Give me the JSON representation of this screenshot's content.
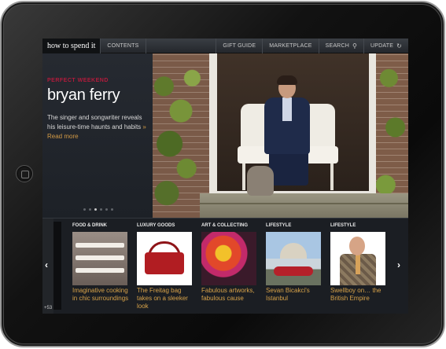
{
  "topbar": {
    "logo": "how to spend it",
    "contents": "CONTENTS",
    "gift_guide": "GIFT GUIDE",
    "marketplace": "MARKETPLACE",
    "search": "SEARCH",
    "update": "UPDATE"
  },
  "hero": {
    "kicker": "PERFECT WEEKEND",
    "headline": "bryan ferry",
    "standfirst": "The singer and songwriter reveals his leisure-time haunts and habits",
    "read_more": "» Read more",
    "active_slide": 3,
    "slide_count": 6
  },
  "strip": {
    "count": "+53",
    "prev_arrow": "‹",
    "next_arrow": "›",
    "cards": [
      {
        "category": "FOOD & DRINK",
        "title": "Imaginative cooking in chic surroundings"
      },
      {
        "category": "LUXURY GOODS",
        "title": "The Freitag bag takes on a sleeker look"
      },
      {
        "category": "ART & COLLECTING",
        "title": "Fabulous artworks, fabulous cause"
      },
      {
        "category": "LIFESTYLE",
        "title": "Sevan Bicakci's Istanbul"
      },
      {
        "category": "LIFESTYLE",
        "title": "Swellboy on… the British Empire"
      }
    ]
  },
  "colors": {
    "kicker": "#b31b3c",
    "card_title": "#d7a249",
    "read_more": "#d29a45"
  }
}
